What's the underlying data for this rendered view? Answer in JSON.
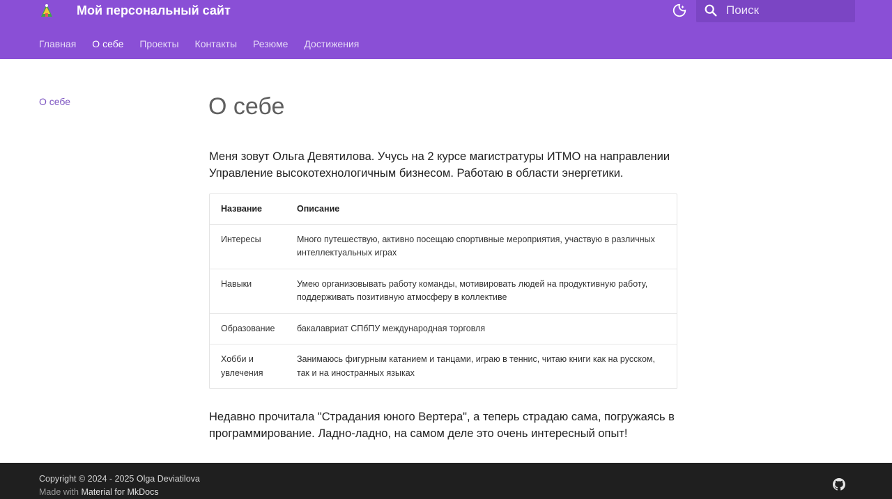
{
  "header": {
    "site_title": "Мой персональный сайт",
    "search_placeholder": "Поиск",
    "accent_color": "#8a4fd6"
  },
  "tabs": [
    {
      "label": "Главная",
      "active": false
    },
    {
      "label": "О себе",
      "active": true
    },
    {
      "label": "Проекты",
      "active": false
    },
    {
      "label": "Контакты",
      "active": false
    },
    {
      "label": "Резюме",
      "active": false
    },
    {
      "label": "Достижения",
      "active": false
    }
  ],
  "toc": {
    "items": [
      "О себе"
    ]
  },
  "main": {
    "title": "О себе",
    "intro": "Меня зовут Ольга Девятилова. Учусь на 2 курсе магистратуры ИТМО на направлении Управление высокотехнологичным бизнесом. Работаю в области энергетики.",
    "table": {
      "headers": [
        "Название",
        "Описание"
      ],
      "rows": [
        [
          "Интересы",
          "Много путешествую, активно посещаю спортивные мероприятия, участвую в различных интеллектуальных играх"
        ],
        [
          "Навыки",
          "Умею организовывать работу команды, мотивировать людей на продуктивную работу, поддерживать позитивную атмосферу в коллективе"
        ],
        [
          "Образование",
          "бакалавриат СПбПУ международная торговля"
        ],
        [
          "Хобби и увлечения",
          "Занимаюсь фигурным катанием и танцами, играю в теннис, читаю книги как на русском, так и на иностранных языках"
        ]
      ]
    },
    "outro": "Недавно прочитала \"Страдания юного Вертера\", а теперь страдаю сама, погружаясь в программирование. Ладно-ладно, на самом деле это очень интересный опыт!"
  },
  "footer": {
    "copyright": "Copyright © 2024 - 2025 Olga Deviatilova",
    "made_with": "Made with",
    "made_with_link": "Material for MkDocs"
  },
  "icons": {
    "logo": "logo-icon",
    "theme": "theme-toggle-icon",
    "search": "search-icon",
    "github": "github-icon"
  }
}
